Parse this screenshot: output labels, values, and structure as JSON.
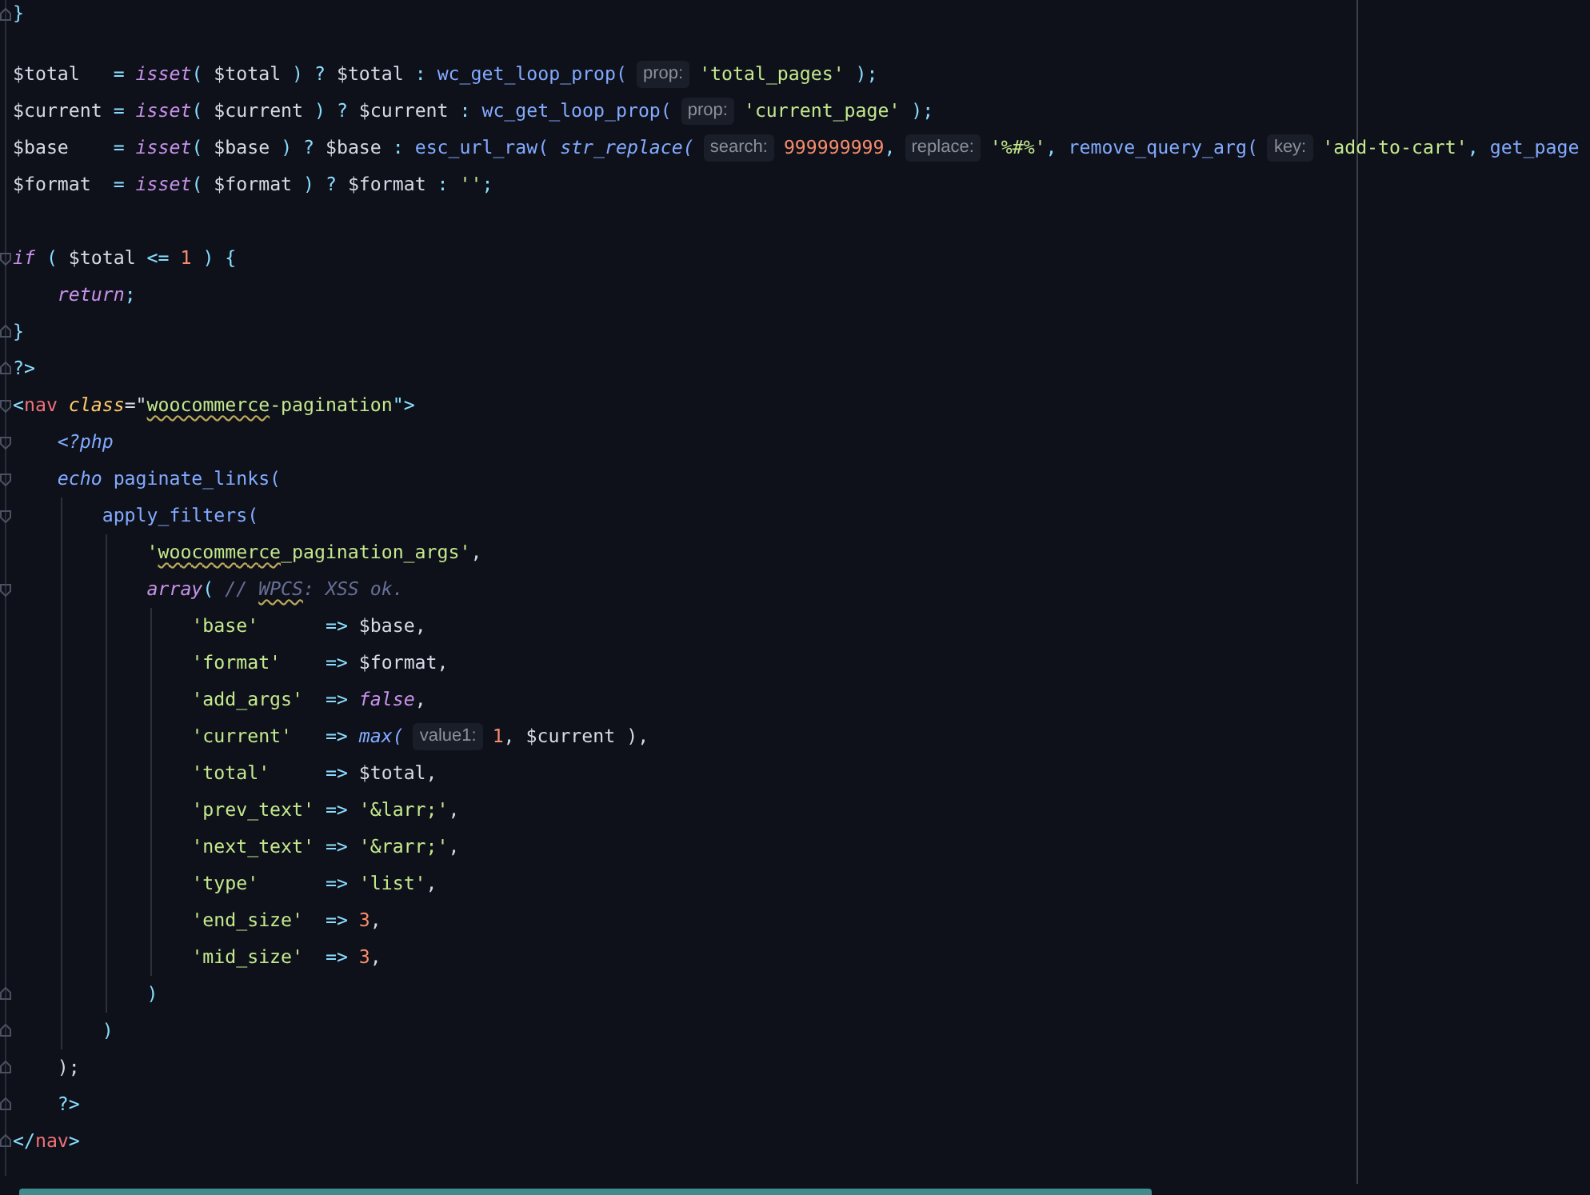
{
  "editor": {
    "lines": [
      {
        "kind": "fold-end",
        "tokens": [
          {
            "text": "}",
            "kind": "punct"
          }
        ]
      },
      {
        "kind": "blank"
      },
      {
        "kind": "plain",
        "tokens": [
          {
            "text": "$total   ",
            "kind": "var"
          },
          {
            "text": "= ",
            "kind": "op"
          },
          {
            "text": "isset",
            "kind": "kw"
          },
          {
            "text": "( ",
            "kind": "punct"
          },
          {
            "text": "$total ",
            "kind": "var"
          },
          {
            "text": ") ? ",
            "kind": "punct"
          },
          {
            "text": "$total ",
            "kind": "var"
          },
          {
            "text": ": ",
            "kind": "punct"
          },
          {
            "text": "wc_get_loop_prop(",
            "kind": "fn"
          },
          {
            "text": "prop:",
            "kind": "hint"
          },
          {
            "text": "'total_pages'",
            "kind": "str"
          },
          {
            "text": " );",
            "kind": "punct"
          }
        ]
      },
      {
        "kind": "plain",
        "tokens": [
          {
            "text": "$current ",
            "kind": "var"
          },
          {
            "text": "= ",
            "kind": "op"
          },
          {
            "text": "isset",
            "kind": "kw"
          },
          {
            "text": "( ",
            "kind": "punct"
          },
          {
            "text": "$current ",
            "kind": "var"
          },
          {
            "text": ") ? ",
            "kind": "punct"
          },
          {
            "text": "$current ",
            "kind": "var"
          },
          {
            "text": ": ",
            "kind": "punct"
          },
          {
            "text": "wc_get_loop_prop(",
            "kind": "fn"
          },
          {
            "text": "prop:",
            "kind": "hint"
          },
          {
            "text": "'current_page'",
            "kind": "str"
          },
          {
            "text": " );",
            "kind": "punct"
          }
        ]
      },
      {
        "kind": "plain",
        "tokens": [
          {
            "text": "$base    ",
            "kind": "var"
          },
          {
            "text": "= ",
            "kind": "op"
          },
          {
            "text": "isset",
            "kind": "kw"
          },
          {
            "text": "( ",
            "kind": "punct"
          },
          {
            "text": "$base ",
            "kind": "var"
          },
          {
            "text": ") ? ",
            "kind": "punct"
          },
          {
            "text": "$base ",
            "kind": "var"
          },
          {
            "text": ": ",
            "kind": "punct"
          },
          {
            "text": "esc_url_raw( ",
            "kind": "fn"
          },
          {
            "text": "str_replace(",
            "kind": "fn-italic"
          },
          {
            "text": "search:",
            "kind": "hint"
          },
          {
            "text": "999999999",
            "kind": "num"
          },
          {
            "text": ",",
            "kind": "punct"
          },
          {
            "text": "replace:",
            "kind": "hint"
          },
          {
            "text": "'%#%'",
            "kind": "str"
          },
          {
            "text": ", ",
            "kind": "punct"
          },
          {
            "text": "remove_query_arg(",
            "kind": "fn"
          },
          {
            "text": "key:",
            "kind": "hint"
          },
          {
            "text": "'add-to-cart'",
            "kind": "str"
          },
          {
            "text": ", ",
            "kind": "punct"
          },
          {
            "text": "get_page",
            "kind": "fn"
          }
        ]
      },
      {
        "kind": "plain",
        "tokens": [
          {
            "text": "$format  ",
            "kind": "var"
          },
          {
            "text": "= ",
            "kind": "op"
          },
          {
            "text": "isset",
            "kind": "kw"
          },
          {
            "text": "( ",
            "kind": "punct"
          },
          {
            "text": "$format ",
            "kind": "var"
          },
          {
            "text": ") ? ",
            "kind": "punct"
          },
          {
            "text": "$format ",
            "kind": "var"
          },
          {
            "text": ": ",
            "kind": "punct"
          },
          {
            "text": "''",
            "kind": "str"
          },
          {
            "text": ";",
            "kind": "punct"
          }
        ]
      },
      {
        "kind": "blank"
      },
      {
        "kind": "fold-start",
        "tokens": [
          {
            "text": "if",
            "kind": "kw"
          },
          {
            "text": " ( ",
            "kind": "punct"
          },
          {
            "text": "$total ",
            "kind": "var"
          },
          {
            "text": "<= ",
            "kind": "op"
          },
          {
            "text": "1",
            "kind": "num"
          },
          {
            "text": " ) {",
            "kind": "punct"
          }
        ]
      },
      {
        "kind": "plain",
        "tokens": [
          {
            "text": "    return",
            "kind": "kw"
          },
          {
            "text": ";",
            "kind": "punct"
          }
        ]
      },
      {
        "kind": "fold-end",
        "tokens": [
          {
            "text": "}",
            "kind": "punct"
          }
        ]
      },
      {
        "kind": "fold-end",
        "tokens": [
          {
            "text": "?>",
            "kind": "punct"
          }
        ]
      },
      {
        "kind": "fold-start",
        "tokens": [
          {
            "text": "<",
            "kind": "punct"
          },
          {
            "text": "nav",
            "kind": "tag"
          },
          {
            "text": " class",
            "kind": "attr"
          },
          {
            "text": "=\"",
            "kind": "var"
          },
          {
            "text": "woocommerce",
            "kind": "str-typo"
          },
          {
            "text": "-pagination",
            "kind": "str"
          },
          {
            "text": "\">",
            "kind": "punct"
          }
        ]
      },
      {
        "kind": "fold-start",
        "tokens": [
          {
            "text": "    <?php",
            "kind": "php"
          }
        ]
      },
      {
        "kind": "fold-start",
        "tokens": [
          {
            "text": "    echo",
            "kind": "php"
          },
          {
            "text": " paginate_links(",
            "kind": "fn"
          }
        ]
      },
      {
        "kind": "fold-start",
        "tokens": [
          {
            "text": "        apply_filters(",
            "kind": "fn"
          }
        ]
      },
      {
        "kind": "plain",
        "tokens": [
          {
            "text": "            '",
            "kind": "str"
          },
          {
            "text": "woocommerce",
            "kind": "str-typo"
          },
          {
            "text": "_pagination_args'",
            "kind": "str"
          },
          {
            "text": ",",
            "kind": "var"
          }
        ]
      },
      {
        "kind": "fold-start",
        "tokens": [
          {
            "text": "            array",
            "kind": "kw"
          },
          {
            "text": "( ",
            "kind": "punct"
          },
          {
            "text": "// ",
            "kind": "comment"
          },
          {
            "text": "WPCS",
            "kind": "comment-typo"
          },
          {
            "text": ": XSS ok.",
            "kind": "comment"
          }
        ]
      },
      {
        "kind": "plain",
        "tokens": [
          {
            "text": "                'base'",
            "kind": "str"
          },
          {
            "text": "      => ",
            "kind": "op"
          },
          {
            "text": "$base",
            "kind": "var"
          },
          {
            "text": ",",
            "kind": "var"
          }
        ]
      },
      {
        "kind": "plain",
        "tokens": [
          {
            "text": "                'format'",
            "kind": "str"
          },
          {
            "text": "    => ",
            "kind": "op"
          },
          {
            "text": "$format",
            "kind": "var"
          },
          {
            "text": ",",
            "kind": "var"
          }
        ]
      },
      {
        "kind": "plain",
        "tokens": [
          {
            "text": "                'add_args'",
            "kind": "str"
          },
          {
            "text": "  => ",
            "kind": "op"
          },
          {
            "text": "false",
            "kind": "kw"
          },
          {
            "text": ",",
            "kind": "var"
          }
        ]
      },
      {
        "kind": "plain",
        "tokens": [
          {
            "text": "                'current'",
            "kind": "str"
          },
          {
            "text": "   => ",
            "kind": "op"
          },
          {
            "text": "max(",
            "kind": "fn-italic"
          },
          {
            "text": "value1:",
            "kind": "hint"
          },
          {
            "text": "1",
            "kind": "num"
          },
          {
            "text": ", ",
            "kind": "var"
          },
          {
            "text": "$current ",
            "kind": "var"
          },
          {
            "text": "),",
            "kind": "var"
          }
        ]
      },
      {
        "kind": "plain",
        "tokens": [
          {
            "text": "                'total'",
            "kind": "str"
          },
          {
            "text": "     => ",
            "kind": "op"
          },
          {
            "text": "$total",
            "kind": "var"
          },
          {
            "text": ",",
            "kind": "var"
          }
        ]
      },
      {
        "kind": "plain",
        "tokens": [
          {
            "text": "                'prev_text'",
            "kind": "str"
          },
          {
            "text": " => ",
            "kind": "op"
          },
          {
            "text": "'&larr;'",
            "kind": "str"
          },
          {
            "text": ",",
            "kind": "var"
          }
        ]
      },
      {
        "kind": "plain",
        "tokens": [
          {
            "text": "                'next_text'",
            "kind": "str"
          },
          {
            "text": " => ",
            "kind": "op"
          },
          {
            "text": "'&rarr;'",
            "kind": "str"
          },
          {
            "text": ",",
            "kind": "var"
          }
        ]
      },
      {
        "kind": "plain",
        "tokens": [
          {
            "text": "                'type'",
            "kind": "str"
          },
          {
            "text": "      => ",
            "kind": "op"
          },
          {
            "text": "'list'",
            "kind": "str"
          },
          {
            "text": ",",
            "kind": "var"
          }
        ]
      },
      {
        "kind": "plain",
        "tokens": [
          {
            "text": "                'end_size'",
            "kind": "str"
          },
          {
            "text": "  => ",
            "kind": "op"
          },
          {
            "text": "3",
            "kind": "num"
          },
          {
            "text": ",",
            "kind": "var"
          }
        ]
      },
      {
        "kind": "plain",
        "tokens": [
          {
            "text": "                'mid_size'",
            "kind": "str"
          },
          {
            "text": "  => ",
            "kind": "op"
          },
          {
            "text": "3",
            "kind": "num"
          },
          {
            "text": ",",
            "kind": "var"
          }
        ]
      },
      {
        "kind": "fold-end",
        "tokens": [
          {
            "text": "            )",
            "kind": "punct"
          }
        ]
      },
      {
        "kind": "fold-end",
        "tokens": [
          {
            "text": "        )",
            "kind": "punct"
          }
        ]
      },
      {
        "kind": "fold-end",
        "tokens": [
          {
            "text": "    );",
            "kind": "var"
          }
        ]
      },
      {
        "kind": "fold-end",
        "tokens": [
          {
            "text": "    ?>",
            "kind": "punct"
          }
        ]
      },
      {
        "kind": "fold-end",
        "tokens": [
          {
            "text": "</",
            "kind": "punct"
          },
          {
            "text": "nav",
            "kind": "tag"
          },
          {
            "text": ">",
            "kind": "punct"
          }
        ]
      }
    ]
  }
}
